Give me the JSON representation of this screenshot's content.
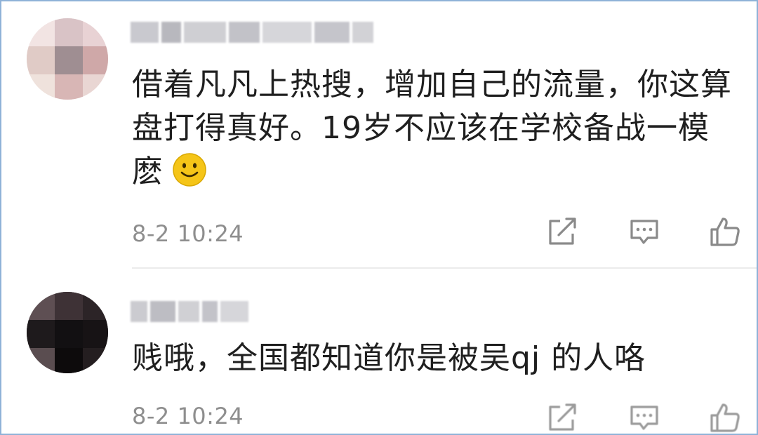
{
  "comments": [
    {
      "username": "",
      "text_line1": "借着凡凡上热搜，增加自己的流量，你这算",
      "text_line2": "盘打得真好。19岁不应该在学校备战一模",
      "text_line3": "麽",
      "emoji": "smile-emoji",
      "time": "8-2 10:24",
      "actions": [
        "share-icon",
        "reply-icon",
        "like-icon"
      ]
    },
    {
      "username": "",
      "text_line1": "贱哦，全国都知道你是被吴qj 的人咯",
      "time": "8-2 10:24",
      "actions": [
        "share-icon",
        "reply-icon",
        "like-icon"
      ]
    }
  ],
  "colors": {
    "frame_border": "#8fb2d8",
    "text": "#1f1f1f",
    "meta": "#8e8e8e",
    "icon": "#8a8a8a",
    "emoji": "#f5c518"
  }
}
